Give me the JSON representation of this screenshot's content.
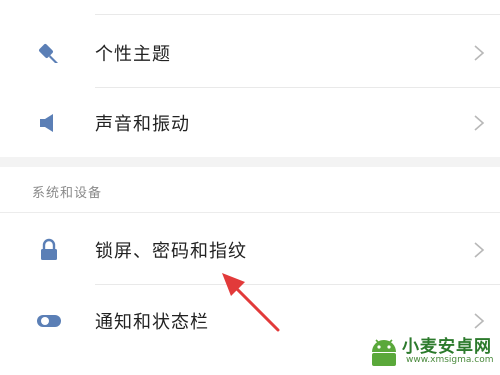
{
  "settings": {
    "rows_top": [
      {
        "label": "个性主题",
        "icon": "theme-brush-icon"
      },
      {
        "label": "声音和振动",
        "icon": "speaker-icon"
      }
    ],
    "section_header": "系统和设备",
    "rows_bottom": [
      {
        "label": "锁屏、密码和指纹",
        "icon": "lock-icon"
      },
      {
        "label": "通知和状态栏",
        "icon": "toggle-icon"
      }
    ]
  },
  "colors": {
    "icon": "#5b7fb6",
    "arrow": "#e23a3a",
    "chevron": "#b8b8b8"
  },
  "watermark": {
    "title": "小麦安卓网",
    "url": "www.xmsigma.com"
  }
}
